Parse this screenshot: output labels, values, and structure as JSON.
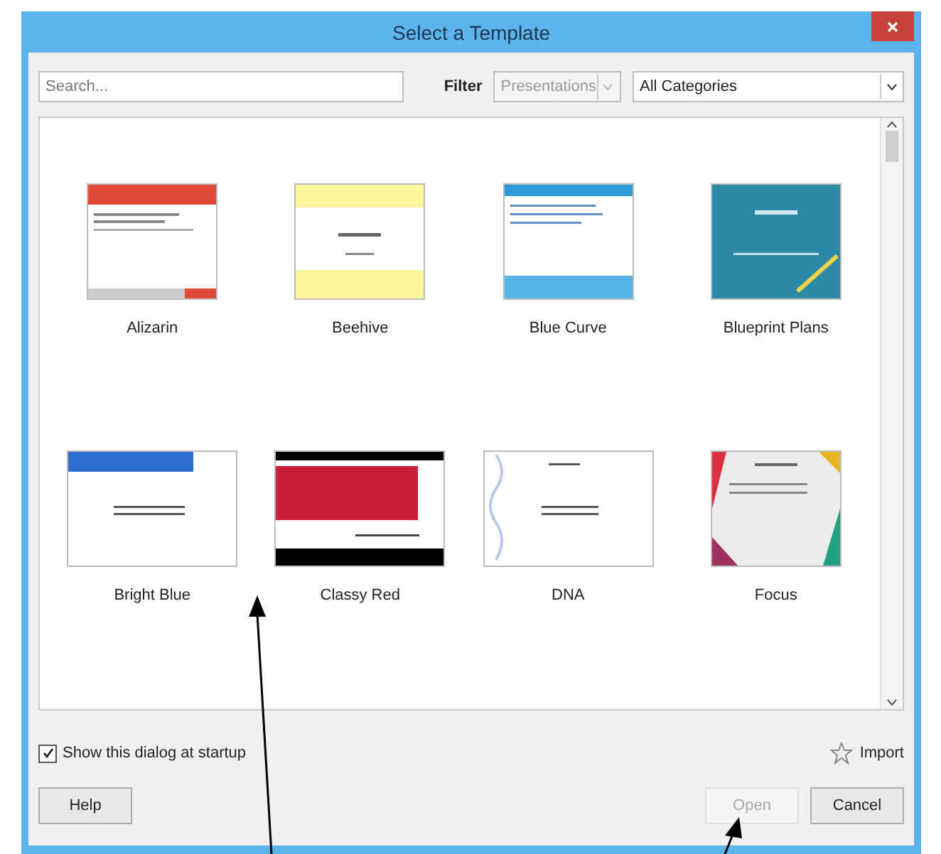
{
  "window": {
    "title": "Select a Template"
  },
  "search": {
    "placeholder": "Search..."
  },
  "filter": {
    "label": "Filter",
    "type_dropdown": {
      "value": "Presentations",
      "disabled": true
    },
    "category_dropdown": {
      "value": "All Categories",
      "disabled": false
    }
  },
  "templates": [
    {
      "name": "Alizarin",
      "kind": "alizarin",
      "selected": false
    },
    {
      "name": "Beehive",
      "kind": "beehive",
      "selected": false
    },
    {
      "name": "Blue Curve",
      "kind": "bluecurve",
      "selected": false
    },
    {
      "name": "Blueprint Plans",
      "kind": "blueprint",
      "selected": false
    },
    {
      "name": "Bright Blue",
      "kind": "brightblue",
      "selected": false
    },
    {
      "name": "Classy Red",
      "kind": "classyred",
      "selected": false
    },
    {
      "name": "DNA",
      "kind": "dna",
      "selected": false
    },
    {
      "name": "Focus",
      "kind": "focus",
      "selected": false
    }
  ],
  "show_at_startup": {
    "label": "Show this dialog at startup",
    "checked": true
  },
  "import_button": {
    "label": "Import"
  },
  "buttons": [
    {
      "label": "Help",
      "kind": "left",
      "disabled": false
    },
    {
      "label": "Open",
      "kind": "right",
      "disabled": true
    },
    {
      "label": "Cancel",
      "kind": "right",
      "disabled": false
    }
  ]
}
